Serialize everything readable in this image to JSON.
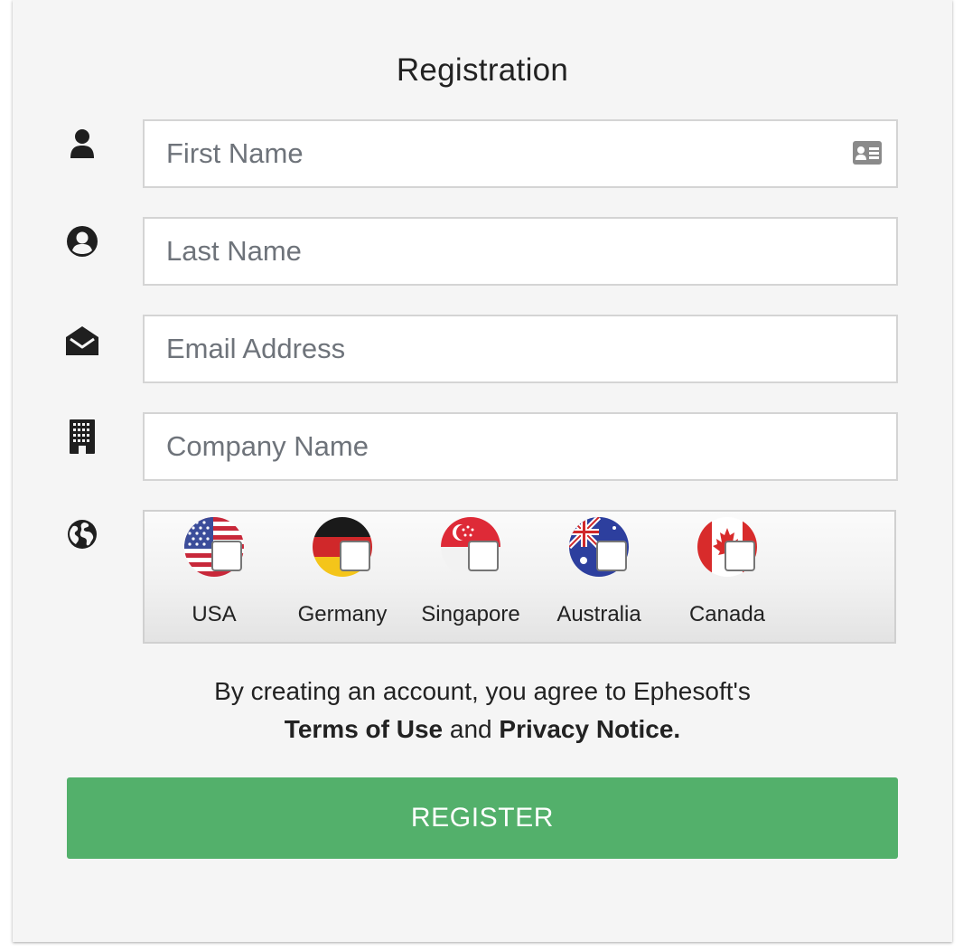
{
  "form": {
    "title": "Registration",
    "fields": {
      "first_name": {
        "placeholder": "First Name",
        "value": ""
      },
      "last_name": {
        "placeholder": "Last Name",
        "value": ""
      },
      "email": {
        "placeholder": "Email Address",
        "value": ""
      },
      "company": {
        "placeholder": "Company Name",
        "value": ""
      }
    },
    "regions": [
      {
        "label": "USA",
        "flag": "usa-flag-icon",
        "checked": false
      },
      {
        "label": "Germany",
        "flag": "germany-flag-icon",
        "checked": false
      },
      {
        "label": "Singapore",
        "flag": "singapore-flag-icon",
        "checked": false
      },
      {
        "label": "Australia",
        "flag": "australia-flag-icon",
        "checked": false
      },
      {
        "label": "Canada",
        "flag": "canada-flag-icon",
        "checked": false
      }
    ],
    "agreement": {
      "line1": "By creating an account, you agree to Ephesoft's",
      "terms_link": "Terms of Use",
      "and_text": " and ",
      "privacy_link": "Privacy Notice."
    },
    "register_label": "REGISTER"
  },
  "icons": {
    "first_name": "user-icon",
    "last_name": "user-circle-icon",
    "email": "envelope-open-icon",
    "company": "building-icon",
    "region": "globe-icon",
    "field_card": "id-card-icon"
  },
  "colors": {
    "card_background": "#f5f5f5",
    "register_button": "#53b06b",
    "field_border": "#d4d4d4",
    "placeholder_text": "#6e737a",
    "icon": "#1f1f1f"
  }
}
